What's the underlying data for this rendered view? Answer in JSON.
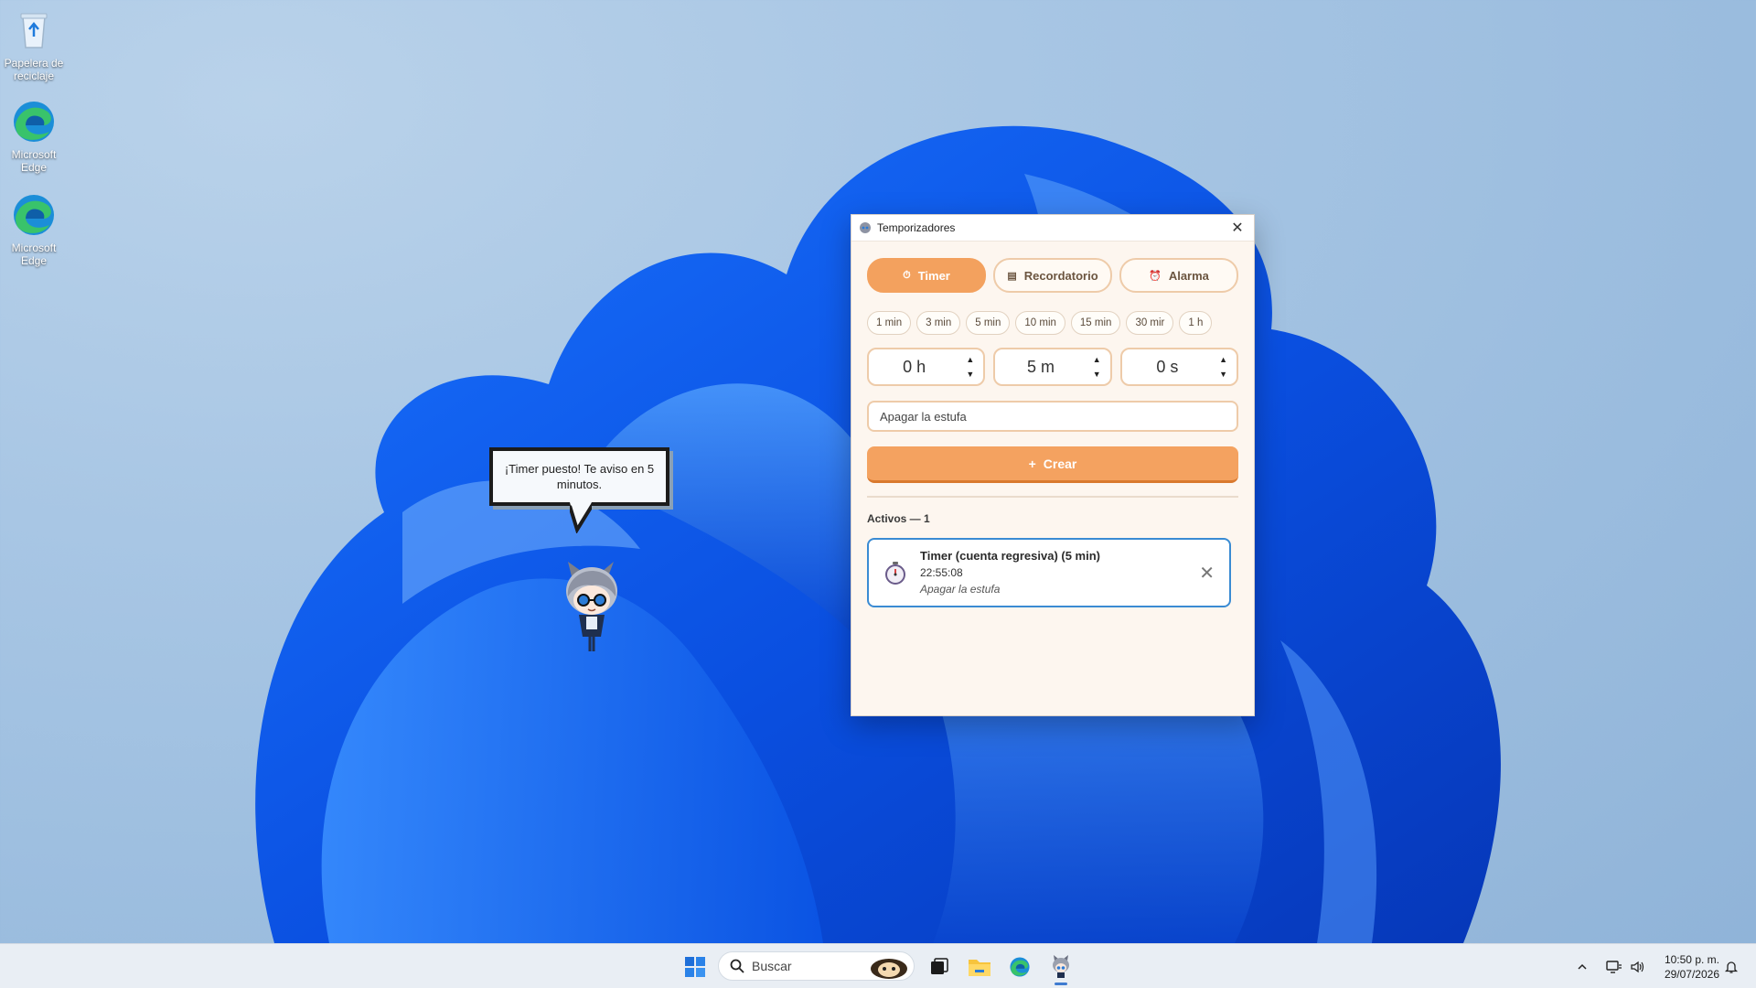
{
  "desktop": {
    "icons": [
      {
        "label": "Papelera de reciclaje",
        "icon": "recycle-bin-icon"
      },
      {
        "label": "Microsoft Edge",
        "icon": "edge-icon"
      },
      {
        "label": "Microsoft Edge",
        "icon": "edge-icon"
      }
    ]
  },
  "window": {
    "title": "Temporizadores",
    "close_glyph": "✕",
    "modes": [
      {
        "label": "Timer",
        "icon": "stopwatch-icon",
        "glyph": "⏱",
        "active": true
      },
      {
        "label": "Recordatorio",
        "icon": "memo-icon",
        "glyph": "▤",
        "active": false
      },
      {
        "label": "Alarma",
        "icon": "alarm-clock-icon",
        "glyph": "⏰",
        "active": false
      }
    ],
    "presets": [
      "1 min",
      "3 min",
      "5 min",
      "10 min",
      "15 min",
      "30 mir",
      "1 h"
    ],
    "spinners": {
      "hours": "0 h",
      "minutes": "5 m",
      "seconds": "0 s",
      "up_glyph": "▲",
      "down_glyph": "▼"
    },
    "note_value": "Apagar la estufa",
    "create_label": "Crear",
    "create_glyph": "+",
    "active_header": "Activos — 1",
    "active_items": [
      {
        "name": "Timer (cuenta regresiva) (5 min)",
        "time": "22:55:08",
        "note": "Apagar la estufa",
        "icon": "stopwatch-icon",
        "delete_glyph": "✕"
      }
    ],
    "colors": {
      "accent": "#f3a15e",
      "card_border": "#3a8bd3",
      "background": "#fdf6ef"
    }
  },
  "bubble": {
    "text": "¡Timer puesto! Te aviso en 5 minutos."
  },
  "taskbar": {
    "search_placeholder": "Buscar",
    "clock_time": "10:50 p. m.",
    "clock_date": "29/07/2026",
    "tray_chevron": "^",
    "apps": [
      "start-icon",
      "search-icon",
      "widgets-icon",
      "task-view-icon",
      "file-explorer-icon",
      "edge-icon",
      "mascot-app-icon"
    ]
  }
}
